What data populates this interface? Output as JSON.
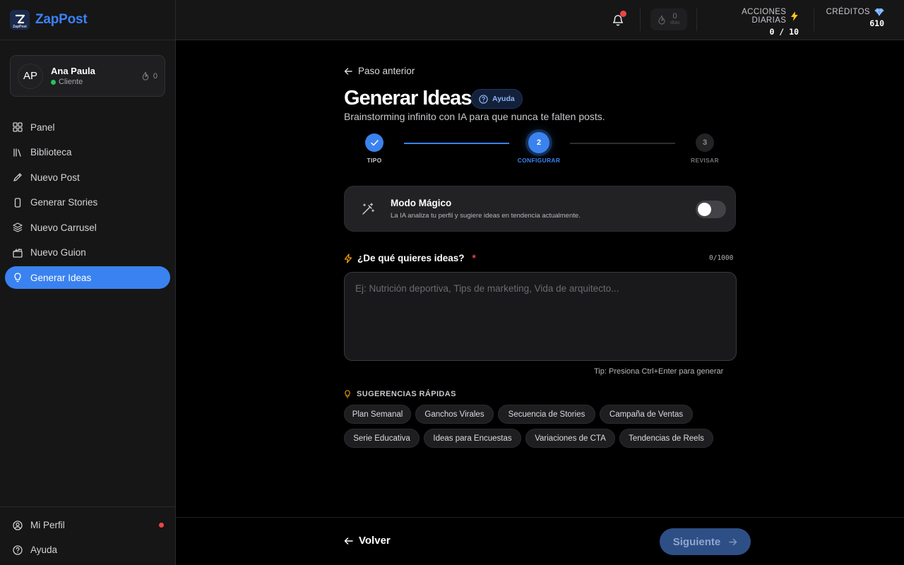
{
  "brand": {
    "name": "ZapPost",
    "logo_sub": "ZapPost"
  },
  "profile": {
    "initials": "AP",
    "name": "Ana Paula",
    "role": "Cliente",
    "streak": "0"
  },
  "sidebar": {
    "items": [
      {
        "label": "Panel",
        "icon": "grid-icon"
      },
      {
        "label": "Biblioteca",
        "icon": "library-icon"
      },
      {
        "label": "Nuevo Post",
        "icon": "pencil-icon"
      },
      {
        "label": "Generar Stories",
        "icon": "phone-icon"
      },
      {
        "label": "Nuevo Carrusel",
        "icon": "layers-icon"
      },
      {
        "label": "Nuevo Guion",
        "icon": "clapper-icon"
      },
      {
        "label": "Generar Ideas",
        "icon": "lightbulb-icon",
        "active": true
      }
    ],
    "bottom": [
      {
        "label": "Mi Perfil",
        "icon": "user-circle-icon"
      },
      {
        "label": "Ayuda",
        "icon": "help-circle-icon"
      }
    ]
  },
  "topbar": {
    "streak_num": "0",
    "streak_label": "días",
    "daily_actions": {
      "label": "ACCIONES DIARIAS",
      "value": "0 / 10"
    },
    "credits": {
      "label": "CRÉDITOS",
      "value": "610"
    }
  },
  "main": {
    "back_link": "Paso anterior",
    "title": "Generar Ideas",
    "help_label": "Ayuda",
    "subtitle": "Brainstorming infinito con IA para que nunca te falten posts.",
    "steps": [
      {
        "number": "1",
        "label": "TIPO",
        "state": "done"
      },
      {
        "number": "2",
        "label": "CONFIGURAR",
        "state": "active"
      },
      {
        "number": "3",
        "label": "REVISAR",
        "state": "pending"
      }
    ],
    "magic": {
      "title": "Modo Mágico",
      "description": "La IA analiza tu perfil y sugiere ideas en tendencia actualmente.",
      "enabled": false
    },
    "question": {
      "label": "¿De qué quieres ideas?",
      "required": "*",
      "counter": "0/1000"
    },
    "input": {
      "value": "",
      "placeholder": "Ej: Nutrición deportiva, Tips de marketing, Vida de arquitecto..."
    },
    "tip": "Tip: Presiona Ctrl+Enter para generar",
    "suggestions_title": "SUGERENCIAS RÁPIDAS",
    "suggestions": [
      "Plan Semanal",
      "Ganchos Virales",
      "Secuencia de Stories",
      "Campaña de Ventas",
      "Serie Educativa",
      "Ideas para Encuestas",
      "Variaciones de CTA",
      "Tendencias de Reels"
    ]
  },
  "footer": {
    "back_label": "Volver",
    "next_label": "Siguiente"
  },
  "colors": {
    "accent": "#3a82f0",
    "danger": "#ef4444",
    "online": "#22c55e",
    "bolt": "#facc15",
    "gem": "#60a5fa"
  }
}
